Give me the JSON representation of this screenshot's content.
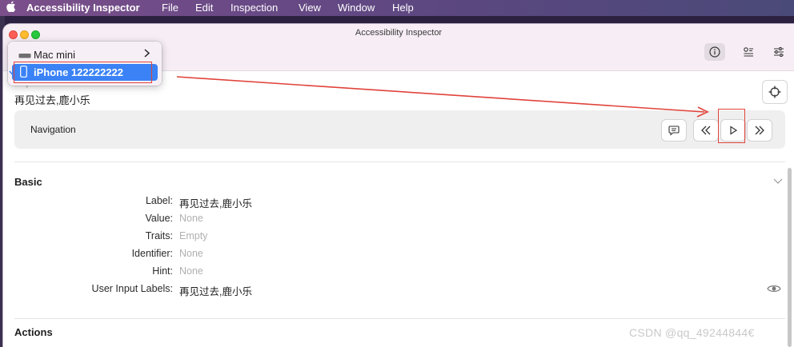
{
  "menubar": {
    "app_name": "Accessibility Inspector",
    "items": [
      "File",
      "Edit",
      "Inspection",
      "View",
      "Window",
      "Help"
    ]
  },
  "window": {
    "title": "Accessibility Inspector"
  },
  "device_menu": {
    "items": [
      {
        "label": "Mac mini",
        "selected": false,
        "has_submenu": true
      },
      {
        "label": "iPhone 122222222",
        "selected": true,
        "has_submenu": false
      }
    ]
  },
  "inspected": {
    "label": "Inspected Element:",
    "value": "再见过去,鹿小乐"
  },
  "navigation": {
    "title": "Navigation"
  },
  "basic": {
    "title": "Basic",
    "rows": [
      {
        "key": "Label:",
        "value": "再见过去,鹿小乐",
        "dim": false
      },
      {
        "key": "Value:",
        "value": "None",
        "dim": true
      },
      {
        "key": "Traits:",
        "value": "Empty",
        "dim": true
      },
      {
        "key": "Identifier:",
        "value": "None",
        "dim": true
      },
      {
        "key": "Hint:",
        "value": "None",
        "dim": true
      },
      {
        "key": "User Input Labels:",
        "value": "再见过去,鹿小乐",
        "dim": false
      }
    ]
  },
  "actions": {
    "title": "Actions"
  },
  "watermark": "CSDN @qq_49244844€",
  "colors": {
    "accent": "#3a82f6",
    "annotation": "#e0433a"
  }
}
